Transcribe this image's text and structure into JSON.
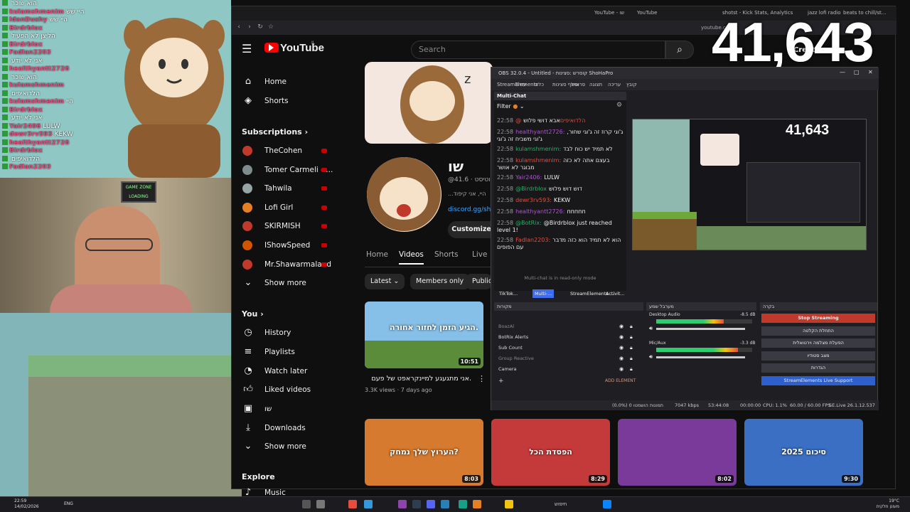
{
  "stream": {
    "chat_lines": [
      {
        "user": "",
        "msg": "הוא שוכר"
      },
      {
        "user": "kulamshmenim",
        "msg": "היי שש"
      },
      {
        "user": "ldanDushy",
        "msg": "היי שש"
      },
      {
        "user": "Birdrblox",
        "msg": ""
      },
      {
        "user": "",
        "msg": "הליצן לא הפעיל"
      },
      {
        "user": "Birdrblox",
        "msg": ""
      },
      {
        "user": "Fadlan2203",
        "msg": ""
      },
      {
        "user": "",
        "msg": "אני לא יודע"
      },
      {
        "user": "healthyantt2726",
        "msg": ""
      },
      {
        "user": "",
        "msg": "הוא שוכר"
      },
      {
        "user": "kulamshmenim",
        "msg": ""
      },
      {
        "user": "",
        "msg": "הלדואיפים"
      },
      {
        "user": "kulamshmenim",
        "msg": "היי"
      },
      {
        "user": "Birdrblox",
        "msg": ""
      },
      {
        "user": "",
        "msg": "אני לא יודע"
      },
      {
        "user": "Yair2406",
        "msg": "LULW"
      },
      {
        "user": "dewr3rv593",
        "msg": "KEKW"
      },
      {
        "user": "healthyantt2726",
        "msg": ""
      },
      {
        "user": "Birdrblox",
        "msg": ""
      },
      {
        "user": "",
        "msg": "הלדואיפים"
      },
      {
        "user": "Fadlan2203",
        "msg": ""
      }
    ],
    "game_zone_label": "GAME ZONE",
    "loading_label": "LOADING"
  },
  "browser": {
    "tabs": [
      {
        "label": "YouTube - שו"
      },
      {
        "label": "YouTube"
      },
      {
        "label": "shotst - Kick Stats, Analytics and Ch..."
      },
      {
        "label": "jazz lofi radio"
      },
      {
        "label": "beats to chill/st..."
      }
    ],
    "address": "youtube.com"
  },
  "viewer_count": "41,643",
  "youtube": {
    "logo_text": "YouTube",
    "logo_sup": "IL",
    "search_placeholder": "Search",
    "create_label": "Create",
    "nav": {
      "home": "Home",
      "shorts": "Shorts",
      "subscriptions_header": "Subscriptions",
      "subscriptions": [
        {
          "name": "TheCohen",
          "color": "#c0392b"
        },
        {
          "name": "Tomer Carmeli - ...",
          "color": "#7f8c8d"
        },
        {
          "name": "Tahwila",
          "color": "#95a5a6"
        },
        {
          "name": "Lofi Girl",
          "color": "#e67e22"
        },
        {
          "name": "SKIRMISH",
          "color": "#c0392b"
        },
        {
          "name": "IShowSpeed",
          "color": "#d35400"
        },
        {
          "name": "Mr.Shawarmaland",
          "color": "#c0392b"
        }
      ],
      "show_more": "Show more",
      "you_header": "You",
      "you_items": [
        "History",
        "Playlists",
        "Watch later",
        "Liked videos",
        "שו",
        "Downloads",
        "Show more"
      ],
      "explore_header": "Explore",
      "explore_items": [
        "Music"
      ]
    },
    "channel": {
      "name": "שו",
      "handle": "@שוטיסט · 41.6...",
      "desc": "...היי, אני קיפוד",
      "link": "discord.gg/shotist",
      "customize": "Customize c"
    },
    "channel_tabs": [
      "Home",
      "Videos",
      "Shorts",
      "Live"
    ],
    "active_tab": "Videos",
    "chips": [
      "Latest",
      "Members only",
      "Public"
    ],
    "featured": {
      "title": "אני מתגעגע למיינקראפט של פעם.",
      "views": "3.3K views",
      "ago": "7 days ago",
      "duration": "10:51",
      "overlay": "הגיע הזמן לחזור אחורה."
    },
    "videos": [
      {
        "duration": "8:03",
        "overlay": "הערוץ שלך נמחק?",
        "color": "#d67a2f"
      },
      {
        "duration": "8:29",
        "overlay": "הפסדת הכל",
        "color": "#c43a3a"
      },
      {
        "duration": "8:02",
        "overlay": "",
        "color": "#7a3a9a"
      },
      {
        "duration": "9:30",
        "overlay": "2025 סיכום",
        "color": "#3a6fc4"
      }
    ]
  },
  "obs": {
    "title": "OBS 32.0.4 - Untitled - קוסרש :סצינות ShoHaPro",
    "menu": [
      "קובץ",
      "עריכה",
      "תצוגה",
      "פרופיל",
      "אוסף סצינות",
      "כלים",
      "עזרה",
      "StreamElements"
    ],
    "multichat_title": "Multi-Chat",
    "filter_label": "Filter",
    "chat": [
      {
        "time": "22:58",
        "user": "@הלדואיפים",
        "msg": "אבא דושי פלוש"
      },
      {
        "time": "22:58",
        "user": "healthyantt2726:",
        "msg": "ג'וגי קרוז זה ג'וגי שחור, ג'וגי משביח זה ג'וגי"
      },
      {
        "time": "22:58",
        "user": "kulamshmenim:",
        "msg": "לא תמיד יש כוח לבד"
      },
      {
        "time": "22:58",
        "user": "kulamshmenim:",
        "msg": "בעצם אתה לא כזה מבוגר לא אושר"
      },
      {
        "time": "22:58",
        "user": "Yair2406:",
        "msg": "LULW"
      },
      {
        "time": "22:58",
        "user": "@Birdrblox",
        "msg": "דוש דוש פלוש"
      },
      {
        "time": "22:58",
        "user": "dewr3rv593:",
        "msg": "KEKW"
      },
      {
        "time": "22:58",
        "user": "healthyantt2726:",
        "msg": "ппппп"
      },
      {
        "time": "22:58",
        "user": "@BotRix:",
        "msg": "@Birdrblox just reached level 1!"
      },
      {
        "time": "22:58",
        "user": "Fadlan2203:",
        "msg": "הוא לא תמיד הוא כזה מדבר עם הפופים"
      }
    ],
    "readonly_note": "Multi-chat is in read-only mode",
    "dock_tabs": [
      "TikTok...",
      "Multi-...",
      "StreamElements ...",
      "Activit..."
    ],
    "sources_header": "מקורות",
    "sources": [
      "BoazAl",
      "BotRix Alerts",
      "Sub Count",
      "Group Reactive",
      "Camera"
    ],
    "add_element": "ADD ELEMENT",
    "mixer_header": "מערבל שמע",
    "mixer": [
      {
        "name": "Desktop Audio",
        "db": "-8.5 dB",
        "level": 0.7
      },
      {
        "name": "Mic/Aux",
        "db": "-3.3 dB",
        "level": 0.85
      }
    ],
    "controls_header": "בקרה",
    "controls": [
      "Stop Streaming",
      "התחלת הקלטה",
      "הפעלת מצלמה וירטואלית",
      "מצב סטודיו",
      "הגדרות",
      "StreamElements Live Support"
    ],
    "status": {
      "dropped": "(0.0%) 0 תמונות הושמטו",
      "kbps": "7047 kbps",
      "time": "53:44:08",
      "rec": "00:00:00",
      "cpu": "CPU: 1.1%",
      "fps": "60.00 / 60.00 FPS",
      "version": "SE.Live 26.1.12.537"
    }
  },
  "taskbar": {
    "time": "22:59",
    "date": "14/02/2026",
    "lang": "ENG",
    "search": "חיפוש",
    "weather": "19°C",
    "weather_note": "מעונן חלקית"
  }
}
